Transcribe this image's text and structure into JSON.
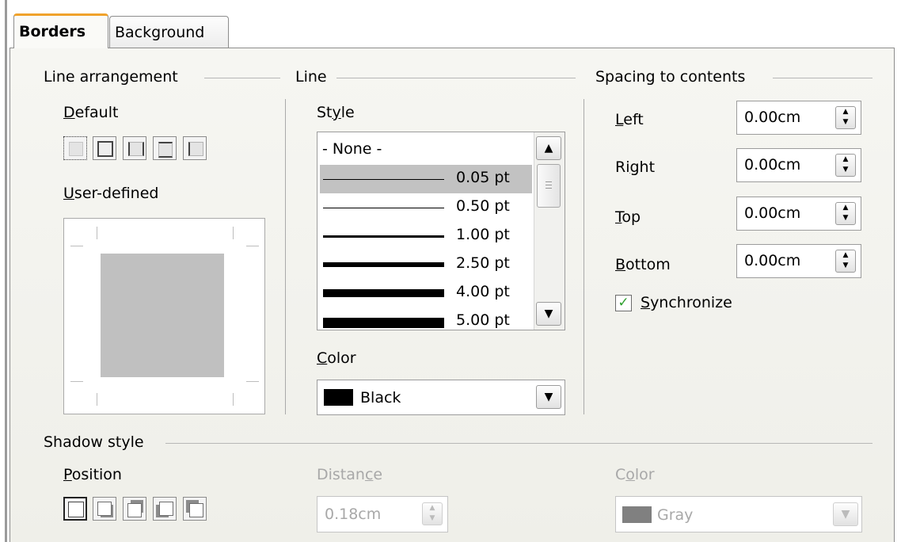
{
  "tabs": [
    {
      "label": "Borders",
      "active": true
    },
    {
      "label": "Background",
      "active": false
    }
  ],
  "line_arrangement": {
    "title": "Line arrangement",
    "default_label": "Default",
    "user_defined_label": "User-defined"
  },
  "line": {
    "title": "Line",
    "style_label": "Style",
    "styles": [
      {
        "label": "- None -"
      },
      {
        "label": "0.05 pt"
      },
      {
        "label": "0.50 pt"
      },
      {
        "label": "1.00 pt"
      },
      {
        "label": "2.50 pt"
      },
      {
        "label": "4.00 pt"
      },
      {
        "label": "5.00 pt"
      }
    ],
    "selected_style": "0.05 pt",
    "color_label": "Color",
    "color_value": "Black",
    "color_swatch": "#000000"
  },
  "spacing": {
    "title": "Spacing to contents",
    "left_label": "Left",
    "left_value": "0.00cm",
    "right_label": "Right",
    "right_value": "0.00cm",
    "top_label": "Top",
    "top_value": "0.00cm",
    "bottom_label": "Bottom",
    "bottom_value": "0.00cm",
    "synchronize_label": "Synchronize",
    "synchronize_checked": true
  },
  "shadow": {
    "title": "Shadow style",
    "position_label": "Position",
    "distance_label": "Distance",
    "distance_value": "0.18cm",
    "color_label": "Color",
    "color_value": "Gray",
    "color_swatch": "#808080"
  },
  "colors": {
    "active_tab_accent": "#f0a22b",
    "checkmark": "#2fa02f",
    "selection": "#c2c2c2"
  }
}
